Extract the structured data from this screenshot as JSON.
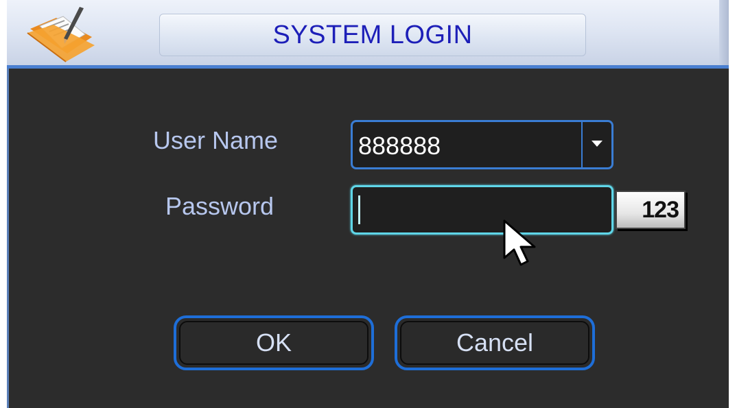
{
  "dialog": {
    "title": "SYSTEM LOGIN"
  },
  "form": {
    "username_label": "User Name",
    "username_value": "888888",
    "password_label": "Password",
    "password_value": "",
    "ime_toggle_label": "123"
  },
  "buttons": {
    "ok_label": "OK",
    "cancel_label": "Cancel"
  },
  "icons": {
    "logo": "folder-pencil-icon",
    "dropdown": "chevron-down-icon",
    "pointer": "mouse-pointer-icon"
  },
  "colors": {
    "title_text": "#1d1fb8",
    "panel_background": "#2c2c2c",
    "label_text": "#b7c7ee",
    "field_border": "#3a7dd4",
    "focused_field_border": "#5fd6e8",
    "button_border": "#1e6ed8"
  }
}
